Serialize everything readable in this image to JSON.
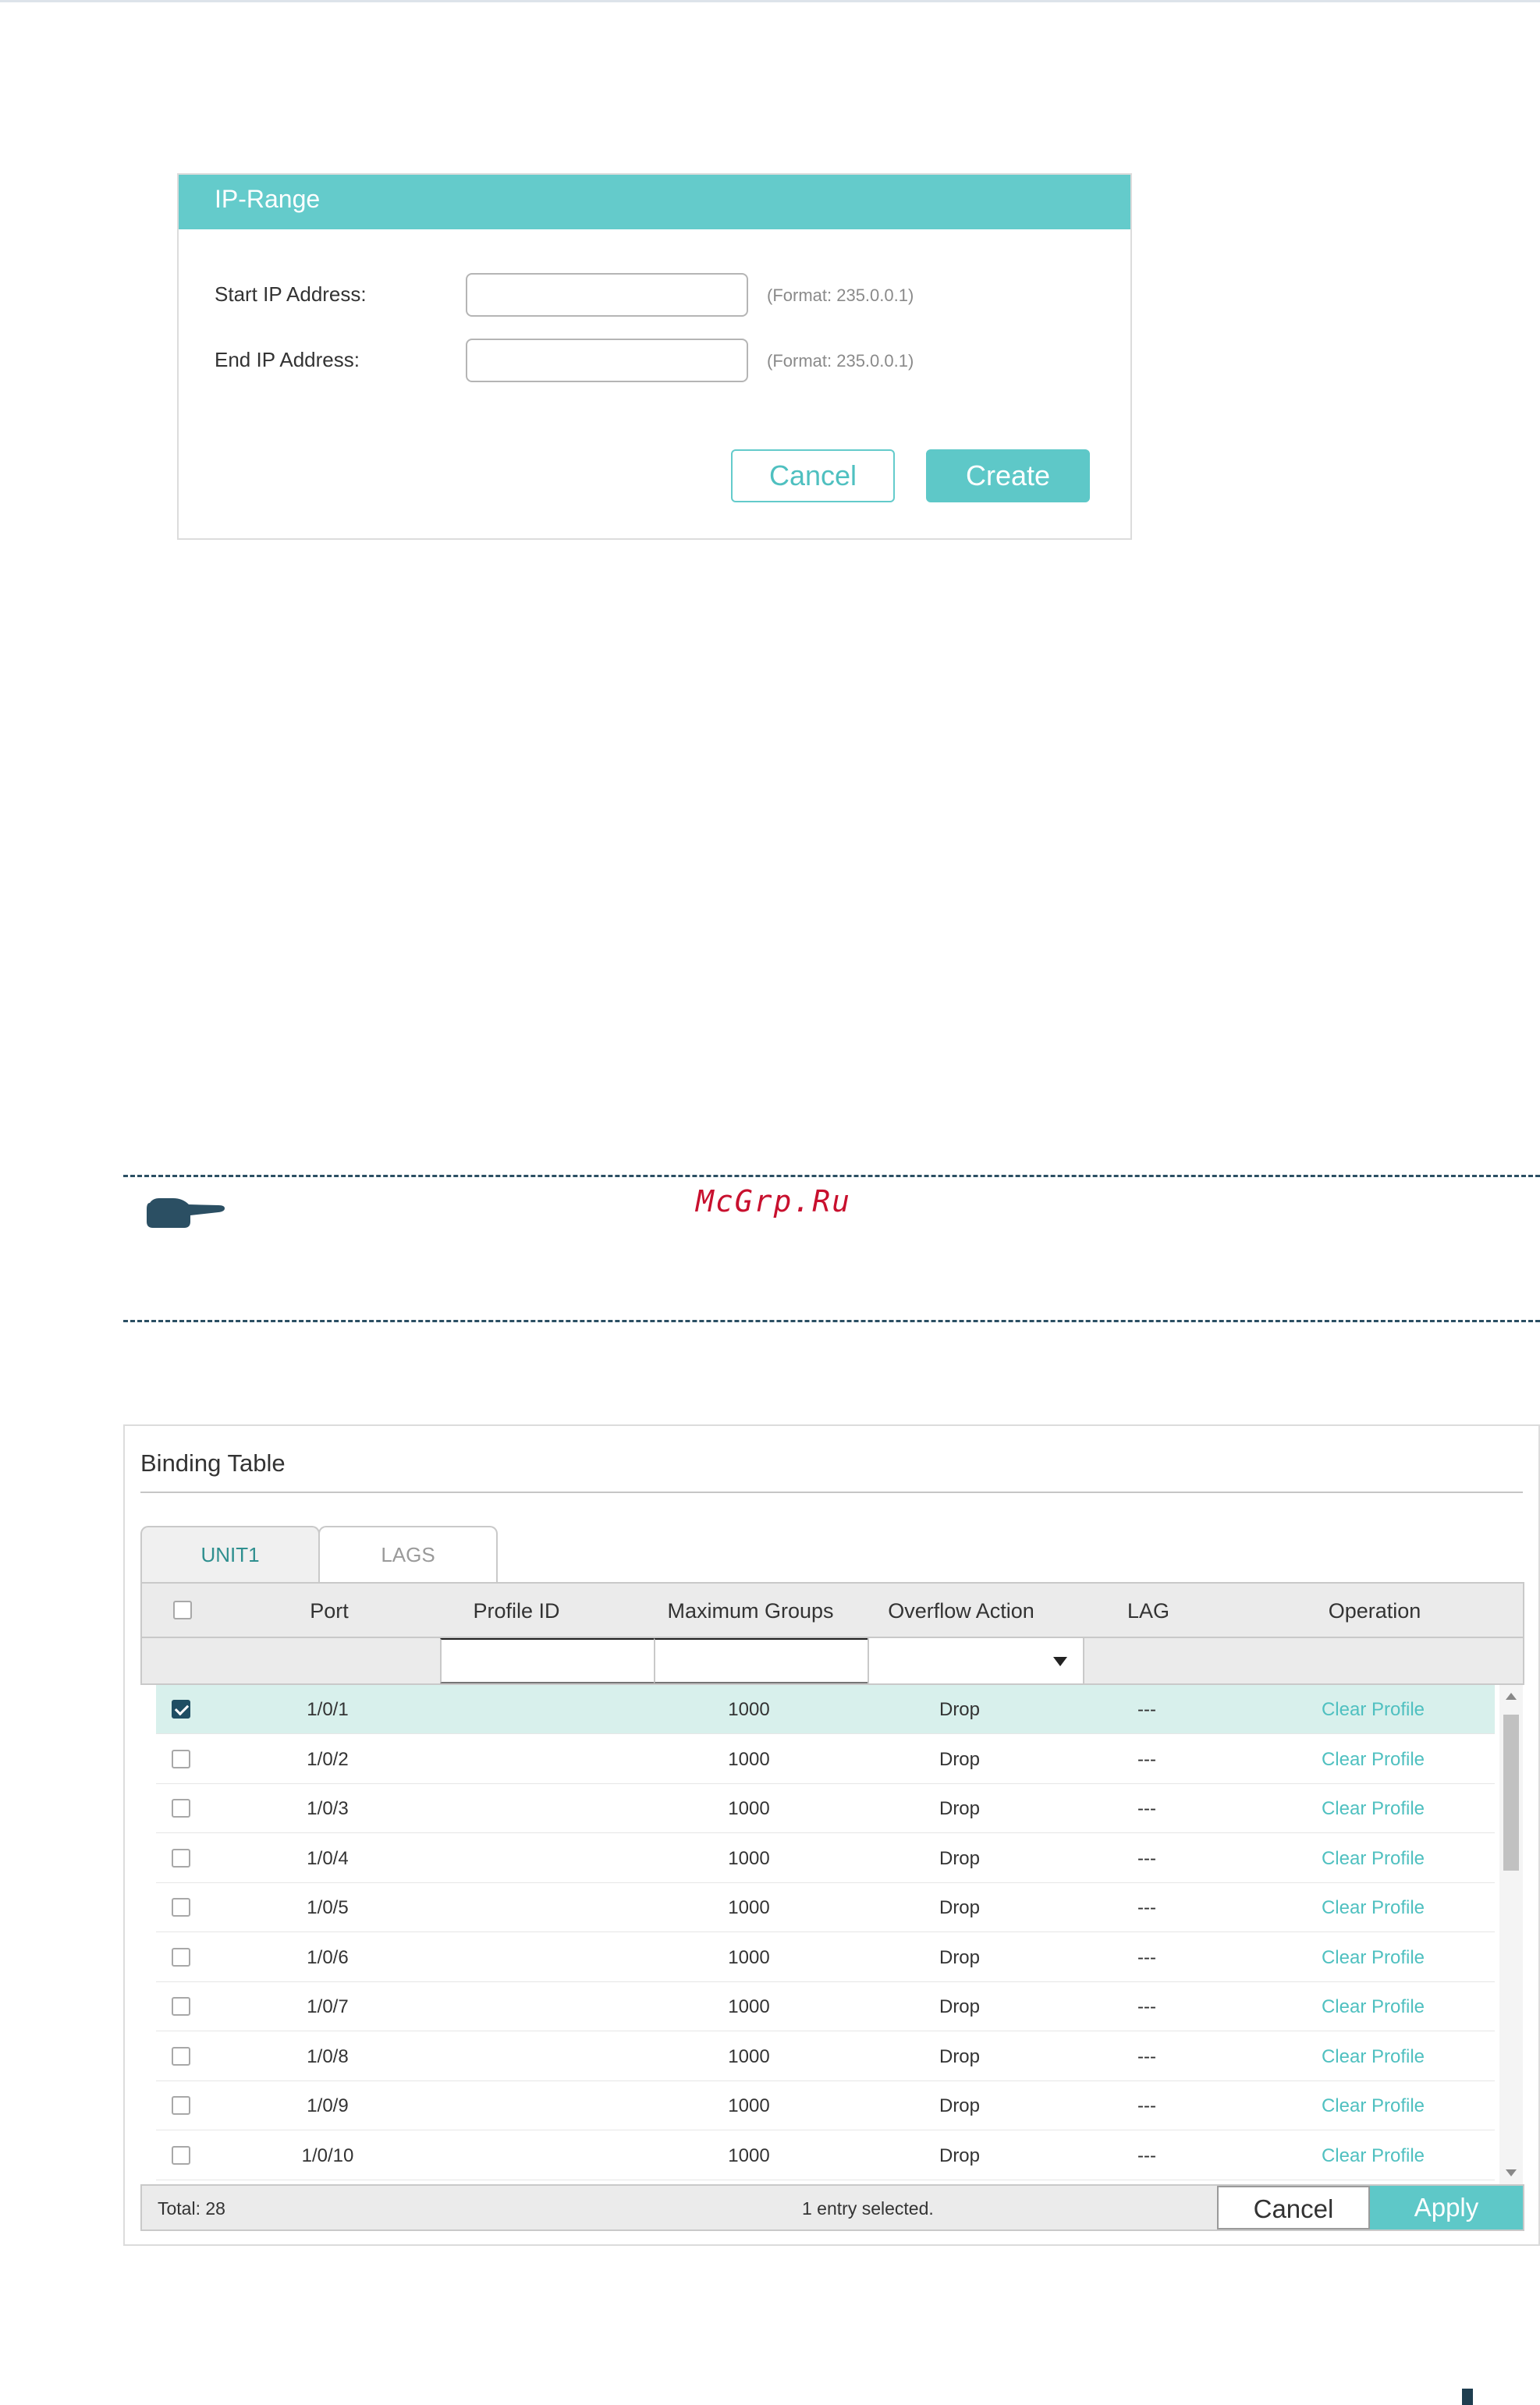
{
  "ip_range": {
    "title": "IP-Range",
    "start_label": "Start IP Address:",
    "start_value": "",
    "start_hint": "(Format: 235.0.0.1)",
    "end_label": "End IP Address:",
    "end_value": "",
    "end_hint": "(Format: 235.0.0.1)",
    "cancel_label": "Cancel",
    "create_label": "Create"
  },
  "note": {
    "icon": "pointing-hand-icon",
    "watermark": "McGrp.Ru"
  },
  "binding_table": {
    "title": "Binding Table",
    "tabs": [
      {
        "label": "UNIT1",
        "active": true
      },
      {
        "label": "LAGS",
        "active": false
      }
    ],
    "columns": [
      "Port",
      "Profile ID",
      "Maximum Groups",
      "Overflow Action",
      "LAG",
      "Operation"
    ],
    "rows": [
      {
        "checked": true,
        "port": "1/0/1",
        "profile_id": "",
        "max_groups": "1000",
        "overflow": "Drop",
        "lag": "---",
        "operation": "Clear Profile"
      },
      {
        "checked": false,
        "port": "1/0/2",
        "profile_id": "",
        "max_groups": "1000",
        "overflow": "Drop",
        "lag": "---",
        "operation": "Clear Profile"
      },
      {
        "checked": false,
        "port": "1/0/3",
        "profile_id": "",
        "max_groups": "1000",
        "overflow": "Drop",
        "lag": "---",
        "operation": "Clear Profile"
      },
      {
        "checked": false,
        "port": "1/0/4",
        "profile_id": "",
        "max_groups": "1000",
        "overflow": "Drop",
        "lag": "---",
        "operation": "Clear Profile"
      },
      {
        "checked": false,
        "port": "1/0/5",
        "profile_id": "",
        "max_groups": "1000",
        "overflow": "Drop",
        "lag": "---",
        "operation": "Clear Profile"
      },
      {
        "checked": false,
        "port": "1/0/6",
        "profile_id": "",
        "max_groups": "1000",
        "overflow": "Drop",
        "lag": "---",
        "operation": "Clear Profile"
      },
      {
        "checked": false,
        "port": "1/0/7",
        "profile_id": "",
        "max_groups": "1000",
        "overflow": "Drop",
        "lag": "---",
        "operation": "Clear Profile"
      },
      {
        "checked": false,
        "port": "1/0/8",
        "profile_id": "",
        "max_groups": "1000",
        "overflow": "Drop",
        "lag": "---",
        "operation": "Clear Profile"
      },
      {
        "checked": false,
        "port": "1/0/9",
        "profile_id": "",
        "max_groups": "1000",
        "overflow": "Drop",
        "lag": "---",
        "operation": "Clear Profile"
      },
      {
        "checked": false,
        "port": "1/0/10",
        "profile_id": "",
        "max_groups": "1000",
        "overflow": "Drop",
        "lag": "---",
        "operation": "Clear Profile"
      }
    ],
    "total": "Total: 28",
    "selected": "1 entry selected.",
    "cancel_label": "Cancel",
    "apply_label": "Apply"
  },
  "colors": {
    "accent": "#5ec8c8",
    "selected_row": "#d8f0ec",
    "checkbox_checked": "#1f4e63",
    "watermark": "#c8102e"
  }
}
